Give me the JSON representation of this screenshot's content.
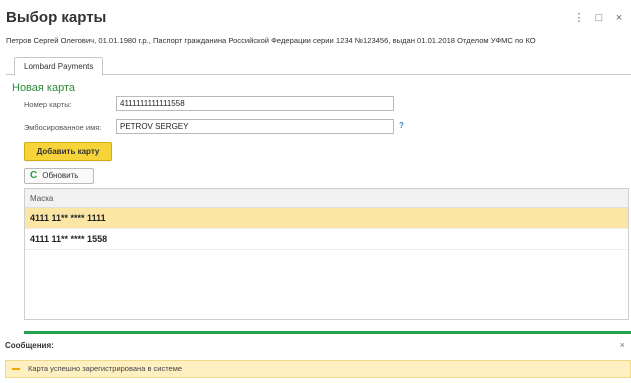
{
  "window": {
    "title": "Выбор карты",
    "menu_glyph": "⋮",
    "maximize_glyph": "□",
    "close_glyph": "×",
    "subtitle": "Петров Сергей Олегович, 01.01.1980 г.р., Паспорт гражданина Российской Федерации серии 1234 №123456, выдан 01.01.2018 Отделом УФМС по КО"
  },
  "tabs": [
    {
      "label": "Lombard Payments",
      "active": true
    }
  ],
  "form": {
    "section_title": "Новая карта",
    "card_number_label": "Номер карты:",
    "card_number_value": "4111111111111558",
    "embossed_name_label": "Эмбосированное имя:",
    "embossed_name_value": "PETROV SERGEY",
    "help_glyph": "?",
    "add_card_label": "Добавить карту",
    "refresh_label": "Обновить",
    "refresh_glyph": "C"
  },
  "table": {
    "header": "Маска",
    "rows": [
      {
        "mask": "4111 11** **** 1111",
        "selected": true
      },
      {
        "mask": "4111 11** **** 1558",
        "selected": false
      }
    ]
  },
  "messages": {
    "title": "Сообщения:",
    "close_glyph": "×",
    "items": [
      {
        "text": "Карта успешно зарегистрирована в системе"
      }
    ]
  },
  "colors": {
    "accent_green": "#2e8b3a",
    "primary_button": "#f6d43a",
    "selected_row": "#fbe6a6",
    "message_bar": "#fff0c2"
  }
}
